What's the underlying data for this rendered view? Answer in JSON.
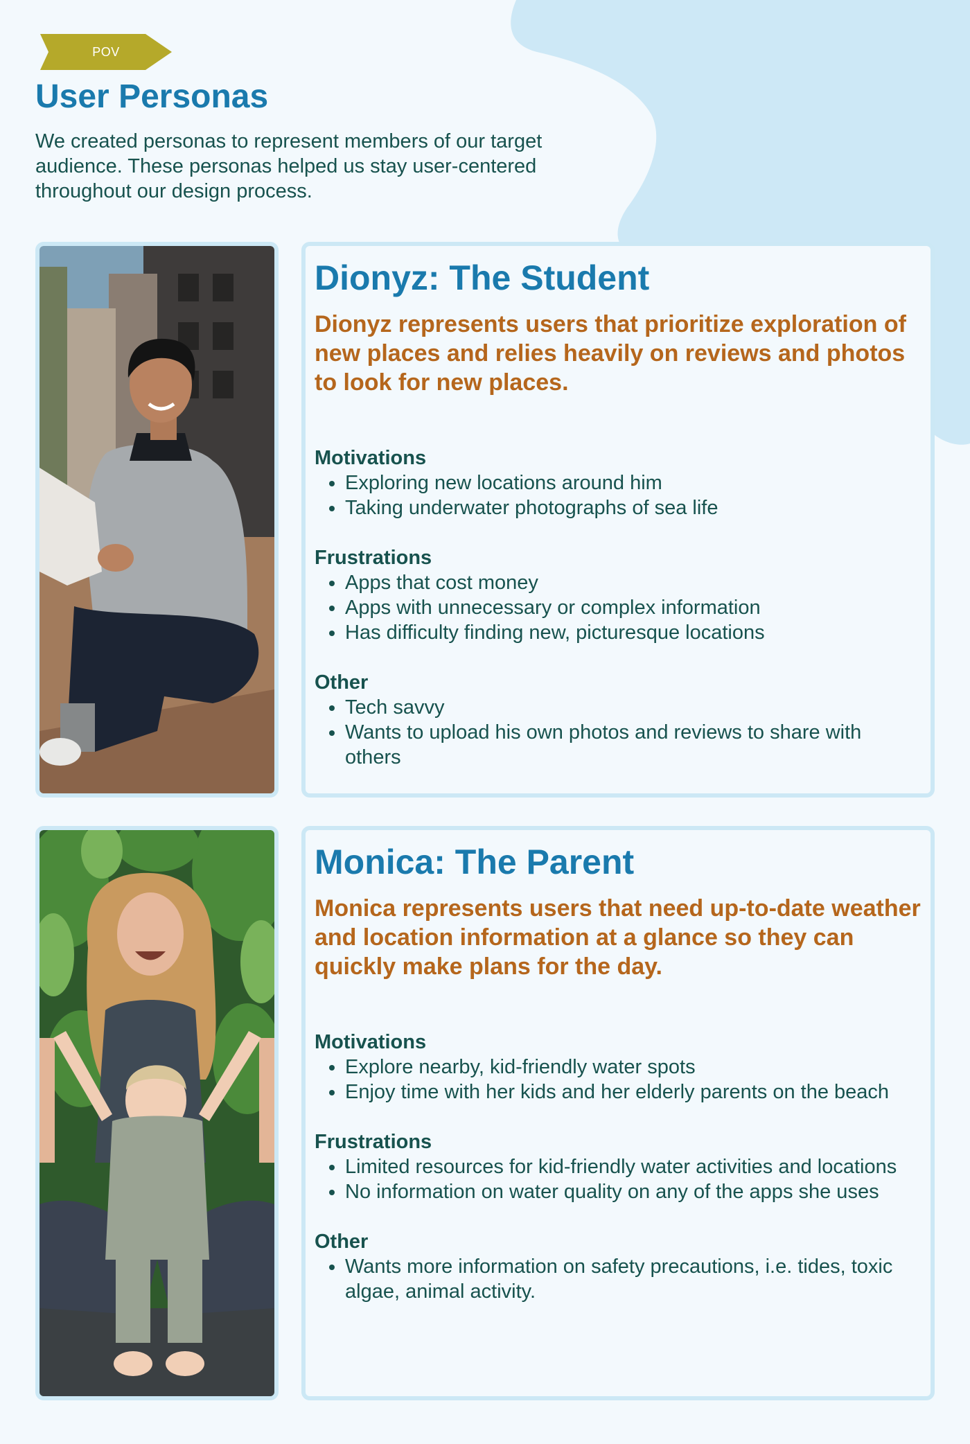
{
  "header": {
    "tag": "POV",
    "title": "User Personas",
    "intro": "We created personas to represent members of our target audience. These personas helped us stay user-centered throughout our design process."
  },
  "colors": {
    "background": "#f3f9fd",
    "title_blue": "#1a7aad",
    "summary_orange": "#b5661c",
    "body_teal": "#17524e",
    "frame_blue": "#cce8f5",
    "tag_olive": "#b5a92a",
    "blob_blue": "#cde8f6"
  },
  "personas": [
    {
      "name": "Dionyz: The Student",
      "photo_icon": "student-photo",
      "summary": "Dionyz represents users that prioritize exploration of new places and relies heavily on reviews and photos to look for new places.",
      "motivations_label": "Motivations",
      "motivations": [
        "Exploring new locations around him",
        "Taking underwater photographs of sea life"
      ],
      "frustrations_label": "Frustrations",
      "frustrations": [
        "Apps that cost money",
        "Apps with unnecessary or complex information",
        "Has difficulty finding new, picturesque locations"
      ],
      "other_label": "Other",
      "other": [
        "Tech savvy",
        "Wants to upload his own photos and reviews to share with others"
      ]
    },
    {
      "name": "Monica: The Parent",
      "photo_icon": "parent-photo",
      "summary": "Monica represents users that need up-to-date weather and location information at a glance so they can quickly make plans for the day.",
      "motivations_label": "Motivations",
      "motivations": [
        "Explore nearby, kid-friendly water spots",
        "Enjoy time with her kids and her elderly parents on the beach"
      ],
      "frustrations_label": "Frustrations",
      "frustrations": [
        "Limited resources for kid-friendly water activities and locations",
        "No information on water quality on any of the apps she uses"
      ],
      "other_label": "Other",
      "other": [
        "Wants more information on safety precautions, i.e. tides, toxic algae, animal activity."
      ]
    }
  ]
}
